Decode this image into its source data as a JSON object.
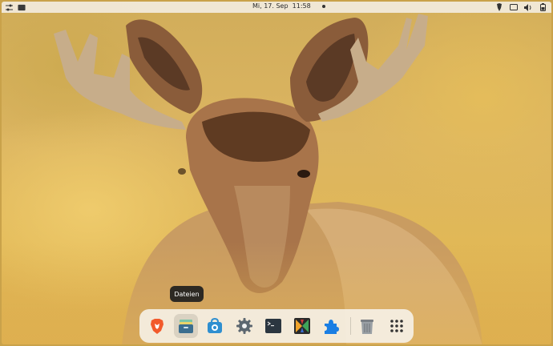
{
  "topbar": {
    "datetime": "Mi, 17. Sep  11:58",
    "left_icons": [
      "settings-sliders-icon",
      "window-switcher-icon"
    ],
    "right_icons": [
      "brave-tray-icon",
      "screen-icon",
      "volume-icon",
      "battery-icon"
    ]
  },
  "dock": {
    "tooltip": "Dateien",
    "apps": [
      {
        "name": "Brave",
        "icon": "brave-icon"
      },
      {
        "name": "Dateien",
        "icon": "files-icon",
        "active": true
      },
      {
        "name": "Software",
        "icon": "software-store-icon"
      },
      {
        "name": "Einstellungen",
        "icon": "settings-gear-icon"
      },
      {
        "name": "Terminal",
        "icon": "terminal-icon"
      },
      {
        "name": "Pinta",
        "icon": "colorful-app-icon"
      },
      {
        "name": "Erweiterungen",
        "icon": "extensions-puzzle-icon"
      },
      {
        "name": "Papierkorb",
        "icon": "trash-icon"
      },
      {
        "name": "Anwendungen anzeigen",
        "icon": "app-grid-icon"
      }
    ]
  },
  "colors": {
    "brave": "#f25a2b",
    "files": "#3b6e8f",
    "store": "#2f8fd0",
    "puzzle": "#1a7ee3",
    "topbar_bg": "#f4f0e8"
  }
}
